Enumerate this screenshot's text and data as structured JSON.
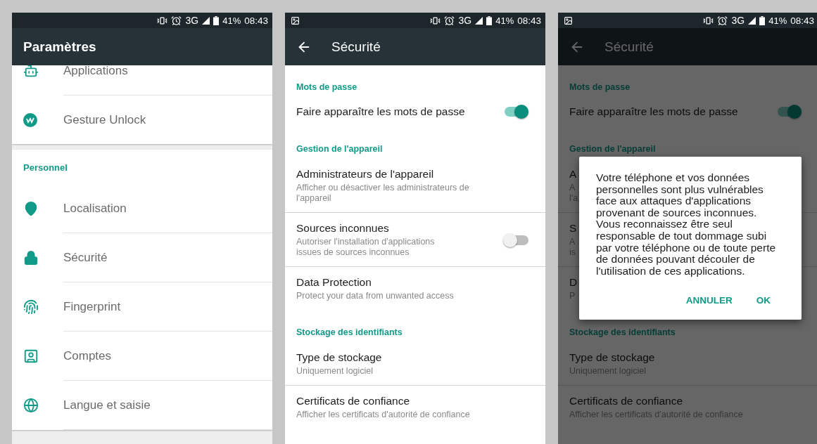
{
  "screens": [
    {
      "status_bar": {
        "notification_icon": false,
        "network": "3G",
        "battery": "41%",
        "time": "08:43"
      },
      "app_bar": {
        "title": "Paramètres",
        "back": false
      },
      "dimmed": false,
      "cards": [
        {
          "items": [
            {
              "title": "Applications"
            },
            {
              "title": "Gesture Unlock"
            }
          ]
        },
        {
          "header": "Personnel",
          "items": [
            {
              "title": "Localisation"
            },
            {
              "title": "Sécurité"
            },
            {
              "title": "Fingerprint"
            },
            {
              "title": "Comptes"
            },
            {
              "title": "Langue et saisie"
            }
          ]
        }
      ]
    },
    {
      "status_bar": {
        "notification_icon": true,
        "network": "3G",
        "battery": "41%",
        "time": "08:43"
      },
      "app_bar": {
        "title": "Sécurité",
        "back": true
      },
      "dimmed": false,
      "items": [
        {
          "kind": "header",
          "text": "Mots de passe"
        },
        {
          "kind": "setting",
          "title": "Faire apparaître les mots de passe",
          "on": true,
          "divider": false
        },
        {
          "kind": "header",
          "text": "Gestion de l'appareil"
        },
        {
          "kind": "setting",
          "title": "Administrateurs de l'appareil",
          "subtitle": "Afficher ou désactiver les administrateurs de\nl'appareil",
          "divider": true
        },
        {
          "kind": "setting",
          "title": "Sources inconnues",
          "subtitle": "Autoriser l'installation d'applications\nissues de sources inconnues",
          "on": false,
          "divider": true
        },
        {
          "kind": "setting",
          "title": "Data Protection",
          "subtitle": "Protect your data from unwanted access",
          "divider": false
        },
        {
          "kind": "header",
          "text": "Stockage des identifiants"
        },
        {
          "kind": "setting",
          "title": "Type de stockage",
          "subtitle": "Uniquement logiciel",
          "divider": true
        },
        {
          "kind": "setting",
          "title": "Certificats de confiance",
          "subtitle": "Afficher les certificats d'autorité de confiance",
          "divider": false
        }
      ]
    },
    {
      "status_bar": {
        "notification_icon": true,
        "network": "3G",
        "battery": "41%",
        "time": "08:43"
      },
      "app_bar": {
        "title": "Sécurité",
        "back": true
      },
      "dimmed": true,
      "items": [
        {
          "kind": "header",
          "text": "Mots de passe"
        },
        {
          "kind": "setting",
          "title": "Faire apparaître les mots de passe",
          "on": true,
          "divider": false
        },
        {
          "kind": "header",
          "text": "Gestion de l'appareil"
        },
        {
          "kind": "setting",
          "title": "A",
          "subtitle": "A\nl'a",
          "divider": true
        },
        {
          "kind": "setting",
          "title": "S",
          "subtitle": "A\nis",
          "divider": true
        },
        {
          "kind": "setting",
          "title": "D",
          "subtitle": "P",
          "divider": false
        },
        {
          "kind": "header",
          "text": "Stockage des identifiants"
        },
        {
          "kind": "setting",
          "title": "Type de stockage",
          "subtitle": "Uniquement logiciel",
          "divider": true
        },
        {
          "kind": "setting",
          "title": "Certificats de confiance",
          "subtitle": "Afficher les certificats d'autorité de confiance",
          "divider": false
        }
      ],
      "dialog": {
        "message": "Votre téléphone et vos données personnelles sont plus vulnérables face aux attaques d'applications provenant de sources inconnues. Vous reconnaissez être seul responsable de tout dommage subi par votre téléphone ou de toute perte de données pouvant découler de l'utilisation de ces applications.",
        "buttons": [
          "ANNULER",
          "OK"
        ]
      }
    }
  ]
}
